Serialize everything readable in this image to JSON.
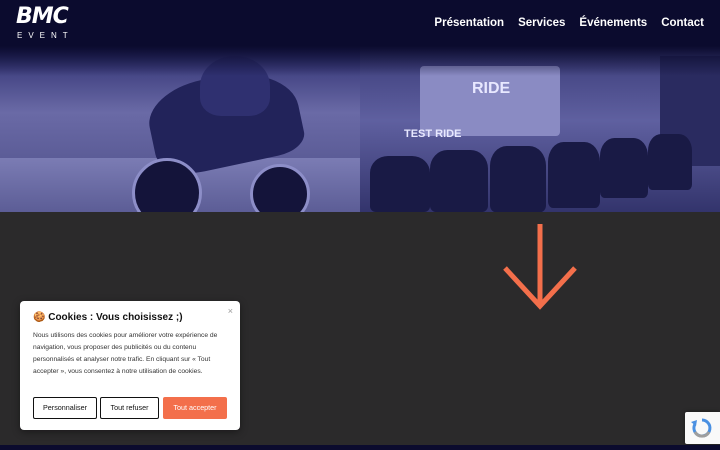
{
  "brand": {
    "logo_mark": "BMC",
    "logo_sub": "EVENT"
  },
  "nav": {
    "items": [
      {
        "label": "Présentation"
      },
      {
        "label": "Services"
      },
      {
        "label": "Événements"
      },
      {
        "label": "Contact"
      }
    ]
  },
  "hero": {
    "sign_text": "TEST RIDE",
    "sign_text_2": "RIDE"
  },
  "colors": {
    "accent": "#f36f4b",
    "header": "#0b0b2e",
    "section": "#2b2a2b"
  },
  "cookie_banner": {
    "close_icon": "×",
    "title": "🍪 Cookies : Vous choisissez ;)",
    "body": "Nous utilisons des cookies pour améliorer votre expérience de navigation, vous proposer des publicités ou du contenu personnalisés et analyser notre trafic. En cliquant sur « Tout accepter », vous consentez à notre utilisation de cookies.",
    "buttons": {
      "customize": "Personnaliser",
      "refuse": "Tout refuser",
      "accept": "Tout accepter"
    }
  },
  "icons": {
    "arrow": "arrow-down-icon",
    "recaptcha": "recaptcha-icon"
  }
}
